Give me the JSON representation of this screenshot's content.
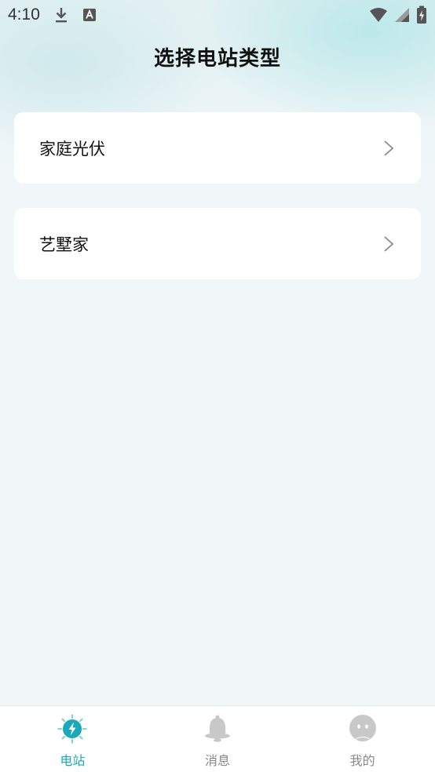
{
  "status_bar": {
    "time": "4:10",
    "icons_left": [
      "download-icon",
      "font-a-icon"
    ],
    "icons_right": [
      "wifi-icon",
      "signal-icon",
      "battery-charging-icon"
    ]
  },
  "header": {
    "title": "选择电站类型"
  },
  "plant_types": [
    {
      "label": "家庭光伏",
      "icon": "chevron-right-icon"
    },
    {
      "label": "艺墅家",
      "icon": "chevron-right-icon"
    }
  ],
  "bottom_nav": {
    "items": [
      {
        "label": "电站",
        "icon": "power-station-icon",
        "active": true
      },
      {
        "label": "消息",
        "icon": "bell-icon",
        "active": false
      },
      {
        "label": "我的",
        "icon": "profile-face-icon",
        "active": false
      }
    ]
  },
  "colors": {
    "accent": "#1ba8b8",
    "inactive": "#888888",
    "card_bg": "#ffffff",
    "page_bg": "#f1f6f9"
  }
}
